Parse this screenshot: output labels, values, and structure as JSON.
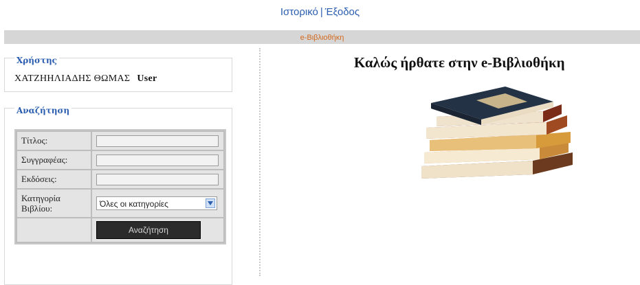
{
  "header": {
    "history_link": "Ιστορικό",
    "separator": "|",
    "logout_link": "Έξοδος",
    "site_title": "e-Βιβλιοθήκη"
  },
  "user_panel": {
    "legend": "Χρήστης",
    "user_name": "ΧΑΤΖΗΗΛΙΑΔΗΣ ΘΩΜΑΣ",
    "role": "User"
  },
  "search_panel": {
    "legend": "Αναζήτηση",
    "fields": [
      {
        "label": "Τίτλος:",
        "value": ""
      },
      {
        "label": "Συγγραφέας:",
        "value": ""
      },
      {
        "label": "Εκδόσεις:",
        "value": ""
      }
    ],
    "category_label": "Κατηγορία Βιβλίου:",
    "category_selected": "Όλες οι κατηγορίες",
    "search_button": "Αναζήτηση"
  },
  "main": {
    "welcome": "Καλώς ήρθατε στην e-Βιβλιοθήκη",
    "image_icon": "book-stack-icon"
  },
  "colors": {
    "link": "#2a5db0",
    "title_accent": "#d2691e",
    "bar": "#d6d6d6",
    "button": "#2b2b2b"
  }
}
